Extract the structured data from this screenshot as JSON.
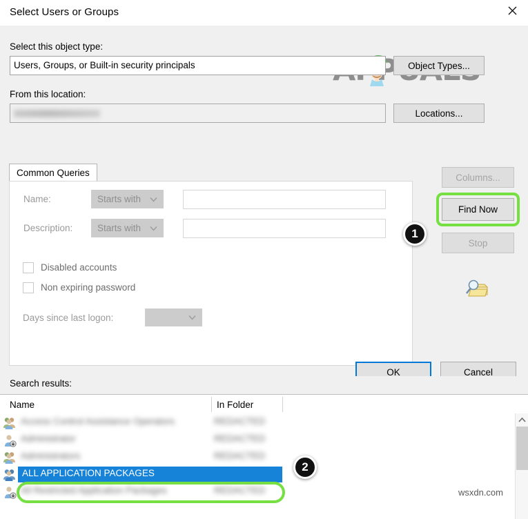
{
  "window": {
    "title": "Select Users or Groups",
    "close_icon": "close-icon"
  },
  "brand": {
    "logo_text": "APPUALS",
    "watermark": "wsxdn.com"
  },
  "object_type": {
    "label": "Select this object type:",
    "value": "Users, Groups, or Built-in security principals",
    "button": "Object Types..."
  },
  "location": {
    "label": "From this location:",
    "value": "",
    "value_redacted": true,
    "button": "Locations..."
  },
  "tabs": [
    {
      "label": "Common Queries",
      "active": true
    }
  ],
  "query": {
    "name_label": "Name:",
    "name_operator": "Starts with",
    "name_value": "",
    "description_label": "Description:",
    "description_operator": "Starts with",
    "description_value": "",
    "disabled_accounts_label": "Disabled accounts",
    "disabled_accounts_checked": false,
    "non_expiring_password_label": "Non expiring password",
    "non_expiring_password_checked": false,
    "days_since_logon_label": "Days since last logon:",
    "days_since_logon_value": ""
  },
  "side_buttons": {
    "columns": "Columns...",
    "find_now": "Find Now",
    "stop": "Stop",
    "search_icon": "search-folder-icon"
  },
  "dialog_buttons": {
    "ok": "OK",
    "cancel": "Cancel"
  },
  "results": {
    "label": "Search results:",
    "columns": [
      "Name",
      "In Folder"
    ],
    "rows": [
      {
        "icon": "group-icon",
        "name": "Access Control Assistance Operators",
        "folder": "REDACTED",
        "redacted": true,
        "selected": false
      },
      {
        "icon": "user-icon",
        "name": "Administrator",
        "folder": "REDACTED",
        "redacted": true,
        "selected": false
      },
      {
        "icon": "group-icon",
        "name": "Administrators",
        "folder": "REDACTED",
        "redacted": true,
        "selected": false
      },
      {
        "icon": "group-icon",
        "name": "ALL APPLICATION PACKAGES",
        "folder": "",
        "redacted": false,
        "selected": true
      },
      {
        "icon": "user-icon",
        "name": "All Restricted Application Packages",
        "folder": "REDACTED",
        "redacted": true,
        "selected": false
      }
    ]
  },
  "annotations": [
    {
      "number": "1",
      "target": "find-now-button"
    },
    {
      "number": "2",
      "target": "selected-result-row"
    }
  ],
  "colors": {
    "highlight_ring": "#76e043",
    "selection_blue": "#1683d8",
    "focus_blue": "#0078d7",
    "dialog_bg": "#f0f0f0",
    "badge_bg": "#111111"
  }
}
